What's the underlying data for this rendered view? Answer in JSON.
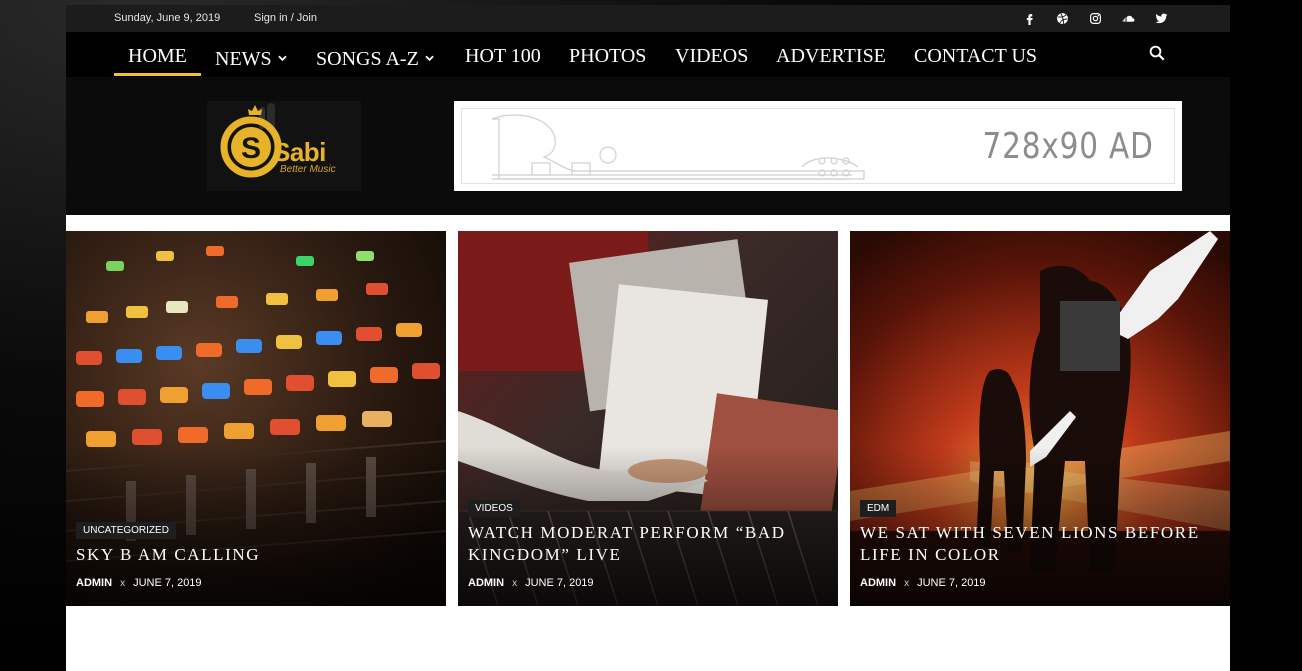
{
  "topbar": {
    "date": "Sunday, June 9, 2019",
    "signin": "Sign in / Join",
    "socials": [
      "facebook-icon",
      "dribbble-icon",
      "instagram-icon",
      "soundcloud-icon",
      "twitter-icon"
    ]
  },
  "nav": {
    "items": [
      {
        "label": "HOME",
        "has_dropdown": false,
        "active": true
      },
      {
        "label": "NEWS",
        "has_dropdown": true
      },
      {
        "label": "SONGS A-Z",
        "has_dropdown": true
      },
      {
        "label": "HOT 100",
        "has_dropdown": false
      },
      {
        "label": "PHOTOS",
        "has_dropdown": false
      },
      {
        "label": "VIDEOS",
        "has_dropdown": false
      },
      {
        "label": "ADVERTISE",
        "has_dropdown": false
      },
      {
        "label": "CONTACT US",
        "has_dropdown": false
      }
    ],
    "active_color": "#f2c22a"
  },
  "header": {
    "logo_text": "Sabi",
    "logo_sub": "Better Music",
    "ad_text": "728x90 AD"
  },
  "cards": [
    {
      "category": "UNCATEGORIZED",
      "title": "SKY B AM CALLING",
      "author": "ADMIN",
      "separator": "x",
      "date": "JUNE 7, 2019"
    },
    {
      "category": "VIDEOS",
      "title": "WATCH MODERAT PERFORM “BAD KINGDOM” LIVE",
      "author": "ADMIN",
      "separator": "x",
      "date": "JUNE 7, 2019"
    },
    {
      "category": "EDM",
      "title": "WE SAT WITH SEVEN LIONS BEFORE LIFE IN COLOR",
      "author": "ADMIN",
      "separator": "x",
      "date": "JUNE 7, 2019"
    }
  ]
}
